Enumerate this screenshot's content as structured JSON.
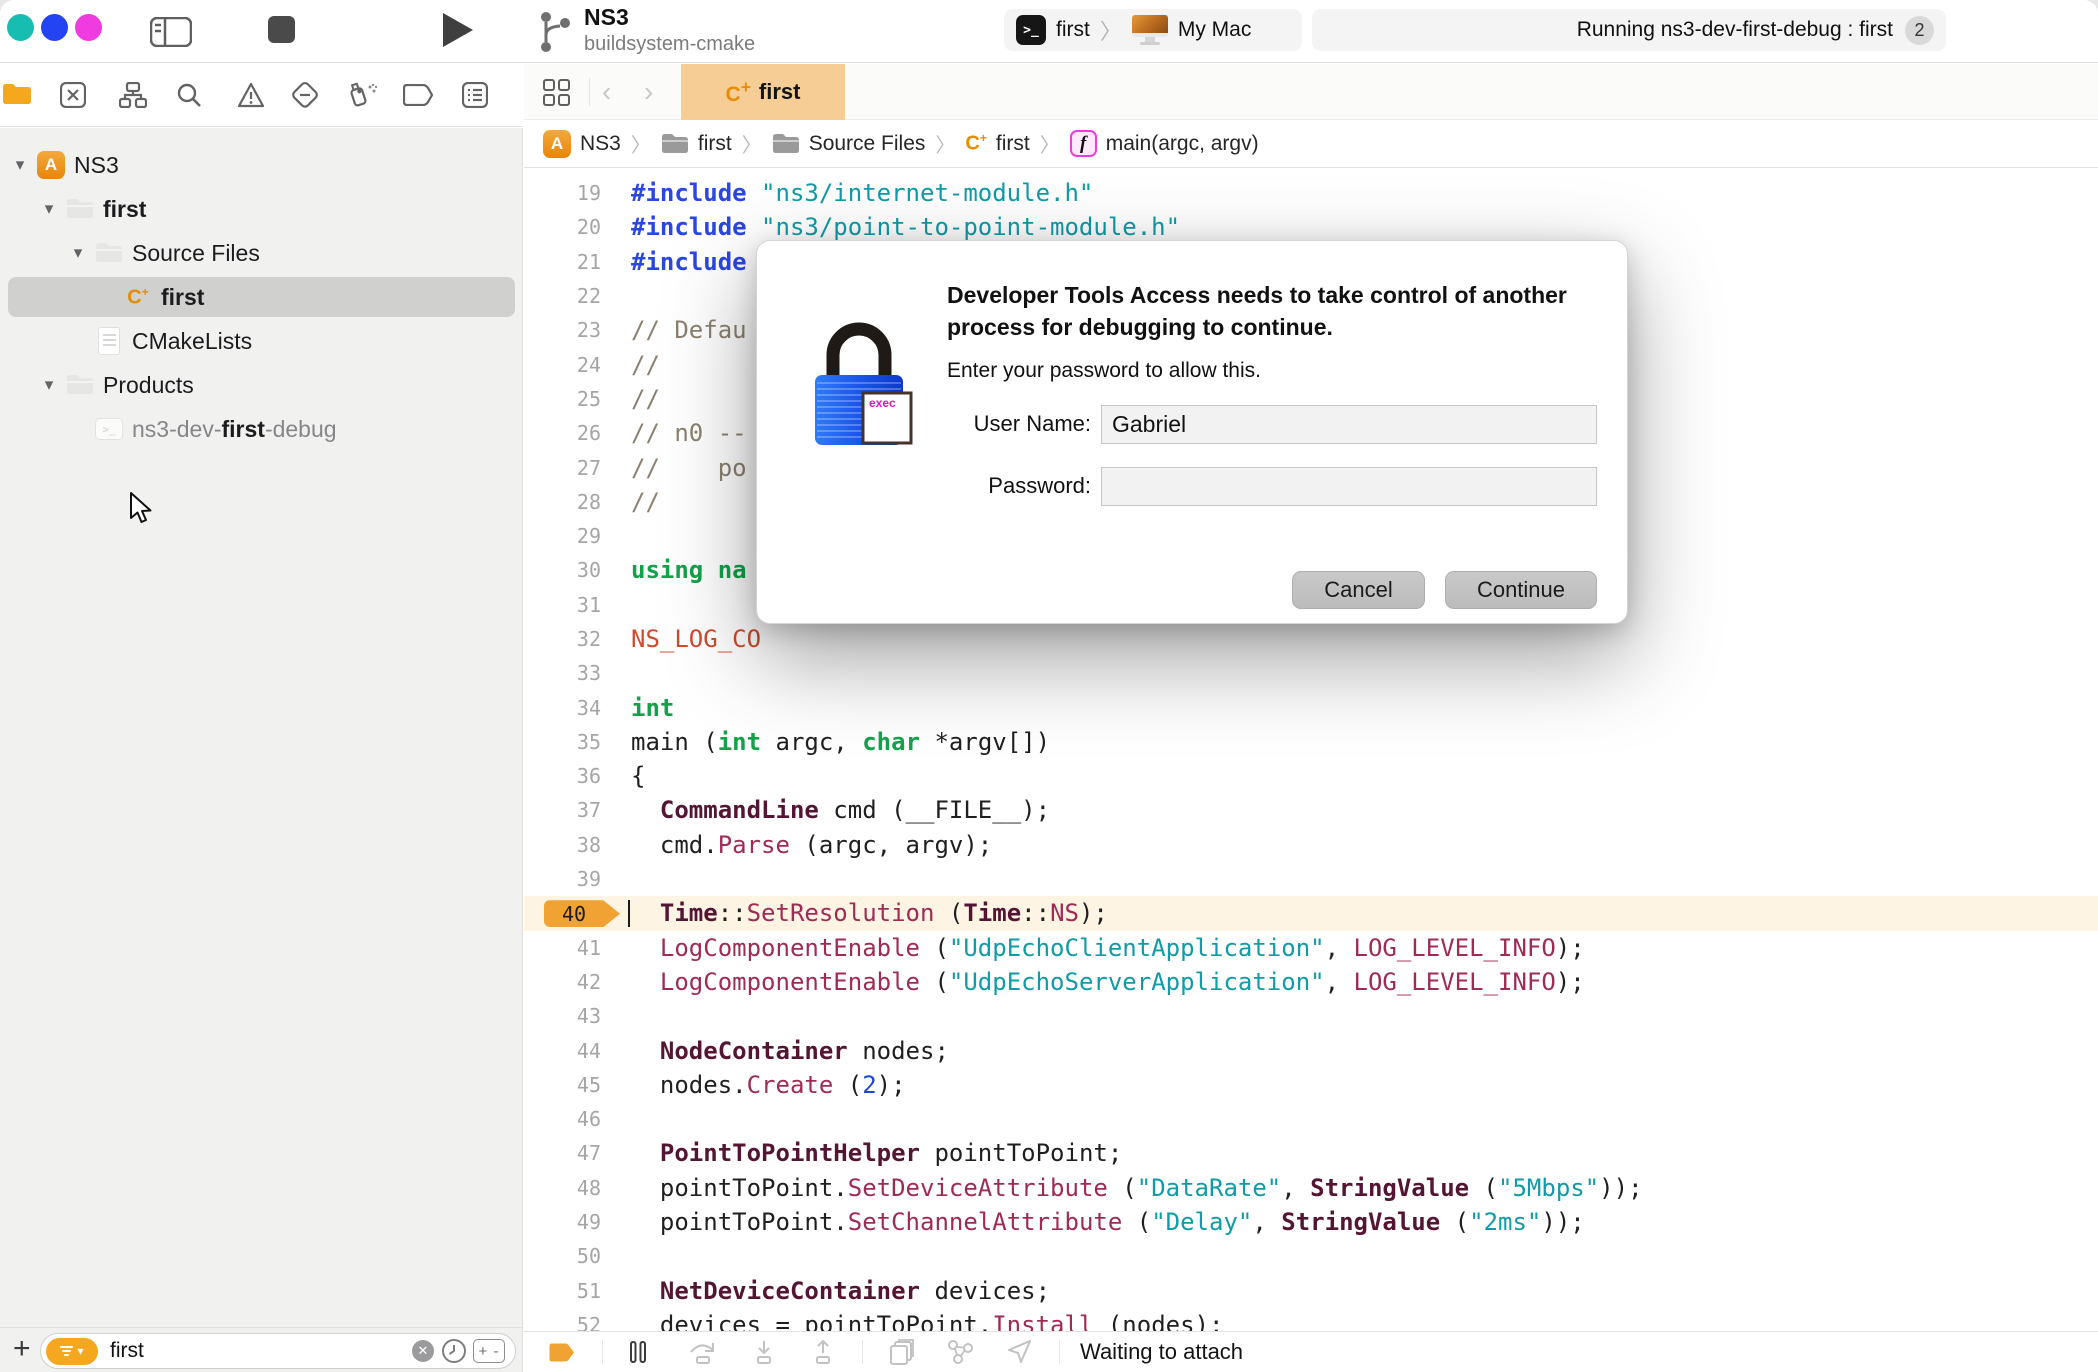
{
  "colors": {
    "traffic_teal": "#18bdb2",
    "traffic_blue": "#2443f2",
    "traffic_magenta": "#ef3be0",
    "accent_orange": "#f0a233",
    "tab_bg": "#f6cd95",
    "filter_orange": "#f5a71e",
    "syntax": {
      "directive": "#2a46e3",
      "string": "#0f9ba8",
      "comment": "#8c8270",
      "keyword": "#13a24a",
      "class": "#541433",
      "function": "#9f2b55",
      "number": "#1b4ad4",
      "macro": "#ce4b2c"
    }
  },
  "toolbar": {
    "project_title": "NS3",
    "project_subtitle": "buildsystem-cmake",
    "scheme": {
      "target": "first",
      "separator": "〉",
      "device": "My Mac",
      "terminal_glyph": ">_"
    },
    "status": {
      "text": "Running ns3-dev-first-debug : first",
      "badge": "2"
    }
  },
  "tabbar": {
    "back_chevron": "‹",
    "forward_chevron": "›",
    "tab": {
      "file_type": "C",
      "file_type_sup": "+",
      "label": "first"
    }
  },
  "breadcrumb": {
    "separator": "〉",
    "items": [
      {
        "icon": "app",
        "label": "NS3"
      },
      {
        "icon": "folder",
        "label": "first"
      },
      {
        "icon": "folder",
        "label": "Source Files"
      },
      {
        "icon": "cpp",
        "label": "first"
      },
      {
        "icon": "fn",
        "label": "main(argc, argv)"
      }
    ],
    "app_glyph": "A",
    "cpp_glyph": "C",
    "cpp_sup": "+",
    "fn_glyph": "f"
  },
  "sidebar": {
    "tree": [
      {
        "depth": 0,
        "chevron": "▾",
        "icon": "app",
        "segments": [
          [
            "n",
            "NS3"
          ]
        ]
      },
      {
        "depth": 1,
        "chevron": "▾",
        "icon": "folder",
        "segments": [
          [
            "b",
            "first"
          ]
        ]
      },
      {
        "depth": 2,
        "chevron": "▾",
        "icon": "folder",
        "segments": [
          [
            "n",
            "Source Files"
          ]
        ]
      },
      {
        "depth": 3,
        "chevron": "",
        "icon": "cpp",
        "segments": [
          [
            "b",
            "first"
          ]
        ],
        "selected": true
      },
      {
        "depth": 2,
        "chevron": "",
        "icon": "doc",
        "segments": [
          [
            "n",
            "CMakeLists"
          ]
        ]
      },
      {
        "depth": 1,
        "chevron": "▾",
        "icon": "folder",
        "segments": [
          [
            "n",
            "Products"
          ]
        ]
      },
      {
        "depth": 2,
        "chevron": "",
        "icon": "exec",
        "segments": [
          [
            "g",
            "ns3-dev-"
          ],
          [
            "bb",
            "first"
          ],
          [
            "g",
            "-debug"
          ]
        ]
      }
    ]
  },
  "filter": {
    "value": "first",
    "clear_glyph": "✕",
    "plus_glyph": "+",
    "plusminus_glyph": "+ -"
  },
  "editor": {
    "lines": [
      {
        "n": 19,
        "segs": [
          [
            "dir",
            "#include"
          ],
          [
            "p",
            " "
          ],
          [
            "str",
            "\"ns3/internet-module.h\""
          ]
        ]
      },
      {
        "n": 20,
        "segs": [
          [
            "dir",
            "#include"
          ],
          [
            "p",
            " "
          ],
          [
            "str",
            "\"ns3/point-to-point-module.h\""
          ]
        ]
      },
      {
        "n": 21,
        "segs": [
          [
            "dir",
            "#include"
          ]
        ]
      },
      {
        "n": 22,
        "segs": []
      },
      {
        "n": 23,
        "segs": [
          [
            "cmt",
            "// Defau"
          ]
        ]
      },
      {
        "n": 24,
        "segs": [
          [
            "cmt",
            "//"
          ]
        ]
      },
      {
        "n": 25,
        "segs": [
          [
            "cmt",
            "//"
          ]
        ]
      },
      {
        "n": 26,
        "segs": [
          [
            "cmt",
            "// n0 --"
          ]
        ]
      },
      {
        "n": 27,
        "segs": [
          [
            "cmt",
            "//    po"
          ]
        ]
      },
      {
        "n": 28,
        "segs": [
          [
            "cmt",
            "//"
          ]
        ]
      },
      {
        "n": 29,
        "segs": []
      },
      {
        "n": 30,
        "segs": [
          [
            "kw",
            "using"
          ],
          [
            "p",
            " "
          ],
          [
            "kw",
            "na"
          ]
        ]
      },
      {
        "n": 31,
        "segs": []
      },
      {
        "n": 32,
        "segs": [
          [
            "macro",
            "NS_LOG_CO"
          ]
        ]
      },
      {
        "n": 33,
        "segs": []
      },
      {
        "n": 34,
        "segs": [
          [
            "kw",
            "int"
          ]
        ]
      },
      {
        "n": 35,
        "segs": [
          [
            "p",
            "main ("
          ],
          [
            "kw",
            "int"
          ],
          [
            "p",
            " argc, "
          ],
          [
            "kw",
            "char"
          ],
          [
            "p",
            " *argv[])"
          ]
        ]
      },
      {
        "n": 36,
        "segs": [
          [
            "p",
            "{"
          ]
        ]
      },
      {
        "n": 37,
        "segs": [
          [
            "p",
            "  "
          ],
          [
            "cls",
            "CommandLine"
          ],
          [
            "p",
            " cmd (__FILE__);"
          ]
        ]
      },
      {
        "n": 38,
        "segs": [
          [
            "p",
            "  cmd."
          ],
          [
            "fn",
            "Parse"
          ],
          [
            "p",
            " (argc, argv);"
          ]
        ]
      },
      {
        "n": 39,
        "segs": []
      },
      {
        "n": 40,
        "breakpoint": true,
        "segs": [
          [
            "p",
            "  "
          ],
          [
            "cls",
            "Time"
          ],
          [
            "p",
            "::"
          ],
          [
            "fn",
            "SetResolution"
          ],
          [
            "p",
            " ("
          ],
          [
            "cls",
            "Time"
          ],
          [
            "p",
            "::"
          ],
          [
            "fn",
            "NS"
          ],
          [
            "p",
            ");"
          ]
        ]
      },
      {
        "n": 41,
        "segs": [
          [
            "p",
            "  "
          ],
          [
            "fn",
            "LogComponentEnable"
          ],
          [
            "p",
            " ("
          ],
          [
            "str",
            "\"UdpEchoClientApplication\""
          ],
          [
            "p",
            ", "
          ],
          [
            "fn",
            "LOG_LEVEL_INFO"
          ],
          [
            "p",
            ");"
          ]
        ]
      },
      {
        "n": 42,
        "segs": [
          [
            "p",
            "  "
          ],
          [
            "fn",
            "LogComponentEnable"
          ],
          [
            "p",
            " ("
          ],
          [
            "str",
            "\"UdpEchoServerApplication\""
          ],
          [
            "p",
            ", "
          ],
          [
            "fn",
            "LOG_LEVEL_INFO"
          ],
          [
            "p",
            ");"
          ]
        ]
      },
      {
        "n": 43,
        "segs": []
      },
      {
        "n": 44,
        "segs": [
          [
            "p",
            "  "
          ],
          [
            "cls",
            "NodeContainer"
          ],
          [
            "p",
            " nodes;"
          ]
        ]
      },
      {
        "n": 45,
        "segs": [
          [
            "p",
            "  nodes."
          ],
          [
            "fn",
            "Create"
          ],
          [
            "p",
            " ("
          ],
          [
            "num",
            "2"
          ],
          [
            "p",
            ");"
          ]
        ]
      },
      {
        "n": 46,
        "segs": []
      },
      {
        "n": 47,
        "segs": [
          [
            "p",
            "  "
          ],
          [
            "cls",
            "PointToPointHelper"
          ],
          [
            "p",
            " pointToPoint;"
          ]
        ]
      },
      {
        "n": 48,
        "segs": [
          [
            "p",
            "  pointToPoint."
          ],
          [
            "fn",
            "SetDeviceAttribute"
          ],
          [
            "p",
            " ("
          ],
          [
            "str",
            "\"DataRate\""
          ],
          [
            "p",
            ", "
          ],
          [
            "cls",
            "StringValue"
          ],
          [
            "p",
            " ("
          ],
          [
            "str",
            "\"5Mbps\""
          ],
          [
            "p",
            "));"
          ]
        ]
      },
      {
        "n": 49,
        "segs": [
          [
            "p",
            "  pointToPoint."
          ],
          [
            "fn",
            "SetChannelAttribute"
          ],
          [
            "p",
            " ("
          ],
          [
            "str",
            "\"Delay\""
          ],
          [
            "p",
            ", "
          ],
          [
            "cls",
            "StringValue"
          ],
          [
            "p",
            " ("
          ],
          [
            "str",
            "\"2ms\""
          ],
          [
            "p",
            "));"
          ]
        ]
      },
      {
        "n": 50,
        "segs": []
      },
      {
        "n": 51,
        "segs": [
          [
            "p",
            "  "
          ],
          [
            "cls",
            "NetDeviceContainer"
          ],
          [
            "p",
            " devices;"
          ]
        ]
      },
      {
        "n": 52,
        "segs": [
          [
            "p",
            "  devices = pointToPoint."
          ],
          [
            "fn",
            "Install"
          ],
          [
            "p",
            " (nodes);"
          ]
        ]
      }
    ]
  },
  "dialog": {
    "title": "Developer Tools Access needs to take control of another process for debugging to continue.",
    "subtitle": "Enter your password to allow this.",
    "username_label": "User Name:",
    "username_value": "Gabriel",
    "password_label": "Password:",
    "password_value": "",
    "cancel_label": "Cancel",
    "continue_label": "Continue",
    "lock_badge": "exec"
  },
  "debugbar": {
    "status": "Waiting to attach"
  }
}
